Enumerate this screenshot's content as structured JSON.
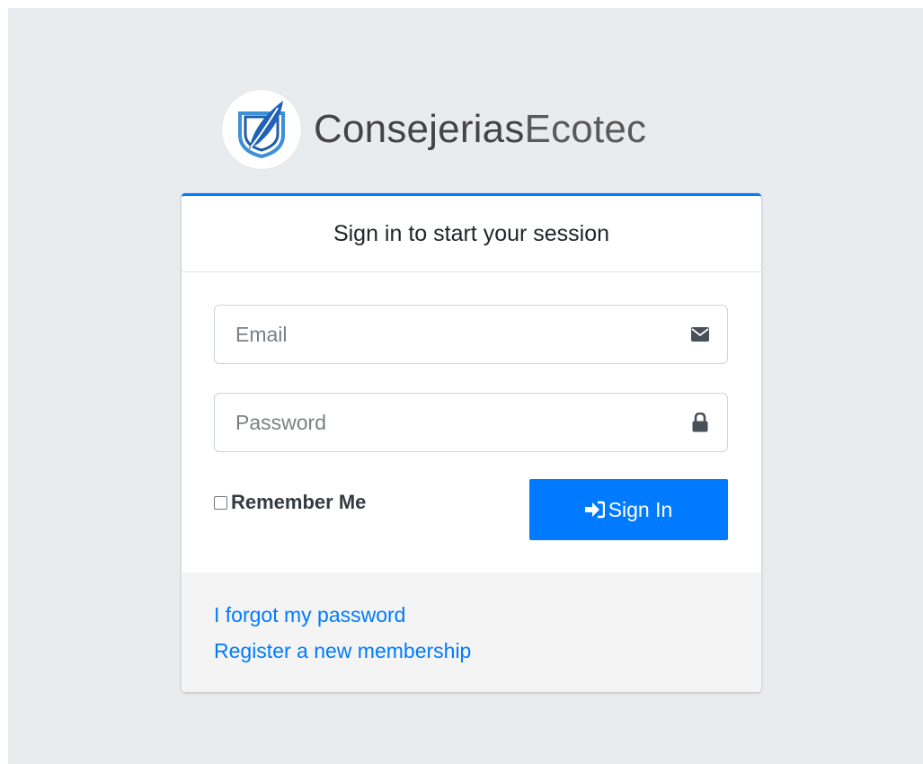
{
  "brand": {
    "name_bold": "Consejerias",
    "name_light": "Ecotec",
    "logo_icon": "shield-quill-icon"
  },
  "login": {
    "header": "Sign in to start your session",
    "email_placeholder": "Email",
    "email_icon": "envelope-icon",
    "password_placeholder": "Password",
    "password_icon": "lock-icon",
    "remember_label": "Remember Me",
    "signin_label": "Sign In",
    "signin_icon": "sign-in-icon"
  },
  "footer": {
    "forgot_password": "I forgot my password",
    "register": "Register a new membership"
  },
  "colors": {
    "accent": "#007bff",
    "page_background": "#e9ecef",
    "footer_background": "#f4f4f5"
  }
}
